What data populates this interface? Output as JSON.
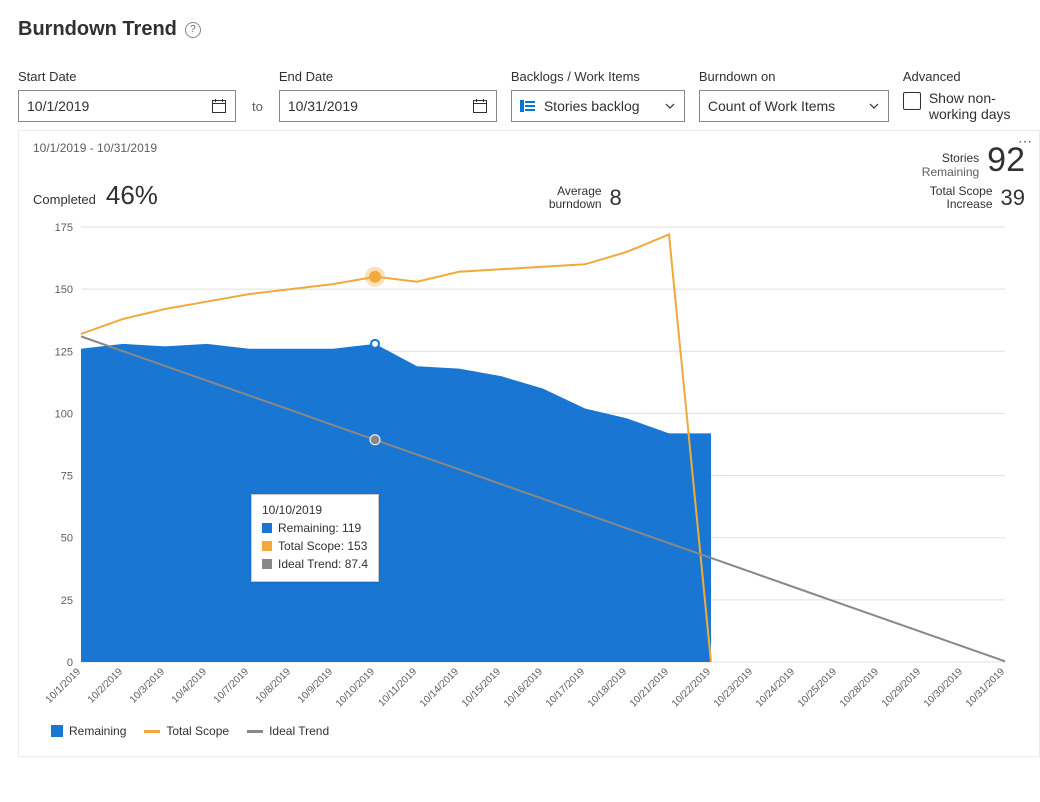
{
  "title": "Burndown Trend",
  "controls": {
    "start_label": "Start Date",
    "start_value": "10/1/2019",
    "to": "to",
    "end_label": "End Date",
    "end_value": "10/31/2019",
    "backlogs_label": "Backlogs / Work Items",
    "backlogs_value": "Stories backlog",
    "burndown_label": "Burndown on",
    "burndown_value": "Count of Work Items",
    "advanced_label": "Advanced",
    "show_nonworking": "Show non-working days"
  },
  "card": {
    "range": "10/1/2019 - 10/31/2019",
    "stories_label": "Stories",
    "remaining_label": "Remaining",
    "stories_value": "92",
    "completed_label": "Completed",
    "completed_value": "46%",
    "avg_label1": "Average",
    "avg_label2": "burndown",
    "avg_value": "8",
    "scope_label1": "Total Scope",
    "scope_label2": "Increase",
    "scope_value": "39"
  },
  "tooltip": {
    "date": "10/10/2019",
    "remaining": "Remaining: 119",
    "totalscope": "Total Scope: 153",
    "ideal": "Ideal Trend: 87.4"
  },
  "legend": {
    "remaining": "Remaining",
    "totalscope": "Total Scope",
    "ideal": "Ideal Trend"
  },
  "chart_data": {
    "type": "area+line",
    "x": [
      "10/1/2019",
      "10/2/2019",
      "10/3/2019",
      "10/4/2019",
      "10/7/2019",
      "10/8/2019",
      "10/9/2019",
      "10/10/2019",
      "10/11/2019",
      "10/14/2019",
      "10/15/2019",
      "10/16/2019",
      "10/17/2019",
      "10/18/2019",
      "10/21/2019",
      "10/22/2019",
      "10/23/2019",
      "10/24/2019",
      "10/25/2019",
      "10/28/2019",
      "10/29/2019",
      "10/30/2019",
      "10/31/2019"
    ],
    "series": [
      {
        "name": "Remaining",
        "type": "area",
        "color": "#1976d2",
        "values": [
          126,
          128,
          127,
          128,
          126,
          126,
          126,
          128,
          119,
          118,
          115,
          110,
          102,
          98,
          92,
          92,
          null,
          null,
          null,
          null,
          null,
          null,
          null,
          null
        ]
      },
      {
        "name": "Total Scope",
        "type": "line",
        "color": "#f2a93b",
        "values": [
          132,
          138,
          142,
          145,
          148,
          150,
          152,
          155,
          153,
          157,
          158,
          159,
          160,
          165,
          172,
          0,
          null,
          null,
          null,
          null,
          null,
          null,
          null
        ]
      },
      {
        "name": "Ideal Trend",
        "type": "line",
        "color": "#8a8886",
        "values": [
          131,
          125.06,
          119.11,
          113.17,
          107.23,
          101.29,
          95.34,
          89.4,
          83.46,
          77.51,
          71.57,
          65.63,
          59.69,
          53.74,
          47.8,
          41.86,
          35.91,
          29.97,
          24.03,
          18.09,
          12.14,
          6.2,
          0.26
        ]
      }
    ],
    "y_ticks": [
      0,
      25,
      50,
      75,
      100,
      125,
      150,
      175
    ],
    "ylim": [
      0,
      175
    ],
    "hover_index": 7,
    "hover": {
      "date": "10/10/2019",
      "Remaining": 119,
      "Total Scope": 153,
      "Ideal Trend": 87.4
    },
    "legend_position": "bottom"
  }
}
